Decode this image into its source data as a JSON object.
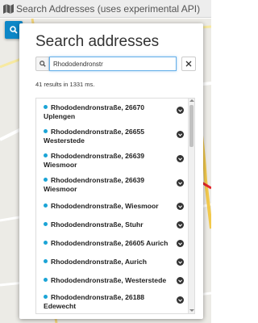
{
  "topbar": {
    "title": "Search Addresses (uses experimental API)",
    "icon": "map-icon"
  },
  "panel": {
    "title": "Search addresses",
    "search": {
      "value": "Rhododendronstr",
      "icon": "search-icon",
      "clear_icon": "close-icon"
    },
    "results_count": "41 results in 1331 ms.",
    "results": [
      {
        "label": "Rhododendronstraße, 26670 Uplengen"
      },
      {
        "label": "Rhododendronstraße, 26655 Westerstede"
      },
      {
        "label": "Rhododendronstraße, 26639 Wiesmoor"
      },
      {
        "label": "Rhododendronstraße, 26639 Wiesmoor"
      },
      {
        "label": "Rhododendronstraße, Wiesmoor"
      },
      {
        "label": "Rhododendronstraße, Stuhr"
      },
      {
        "label": "Rhododendronstraße, 26605 Aurich"
      },
      {
        "label": "Rhododendronstraße, Aurich"
      },
      {
        "label": "Rhododendronstraße, Westerstede"
      },
      {
        "label": "Rhododendronstraße, 26188 Edewecht"
      }
    ]
  },
  "colors": {
    "accent": "#0d87c7",
    "dot": "#1ba4d6"
  }
}
